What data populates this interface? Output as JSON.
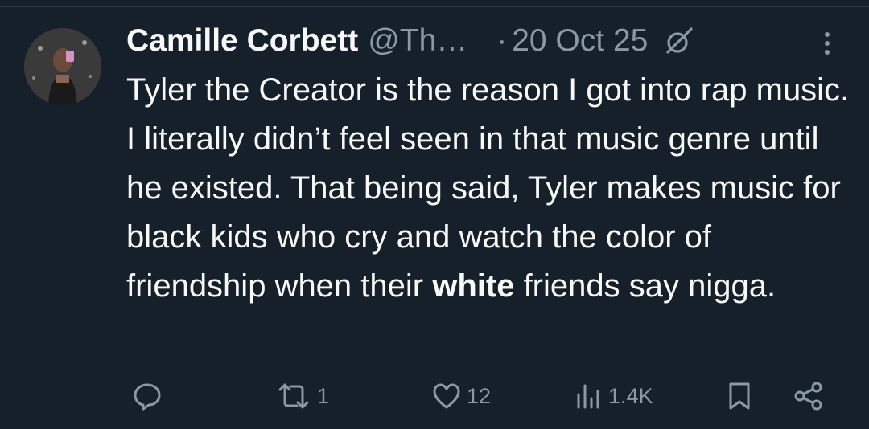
{
  "tweet": {
    "author_name": "Camille Corbett",
    "handle": "@ThatCamilleCorbett",
    "separator": "·",
    "date": "20 Oct 25",
    "text_segments": [
      "Tyler the Creator is the reason I got into rap music. I literally didn’t feel seen in that music genre until he existed. That being said, Tyler makes music for black kids who cry and watch the color of friendship when their ",
      "white",
      " friends say nigga."
    ]
  },
  "actions": {
    "retweets": "1",
    "likes": "12",
    "views": "1.4K"
  },
  "icons": {
    "reply": "reply-icon",
    "retweet": "retweet-icon",
    "like": "heart-icon",
    "views": "analytics-icon",
    "bookmark": "bookmark-icon",
    "share": "share-icon",
    "grok": "grok-icon",
    "more": "more-icon"
  },
  "colors": {
    "background": "#15202b",
    "text_primary": "#f7f9f9",
    "text_secondary": "#8b98a5"
  }
}
